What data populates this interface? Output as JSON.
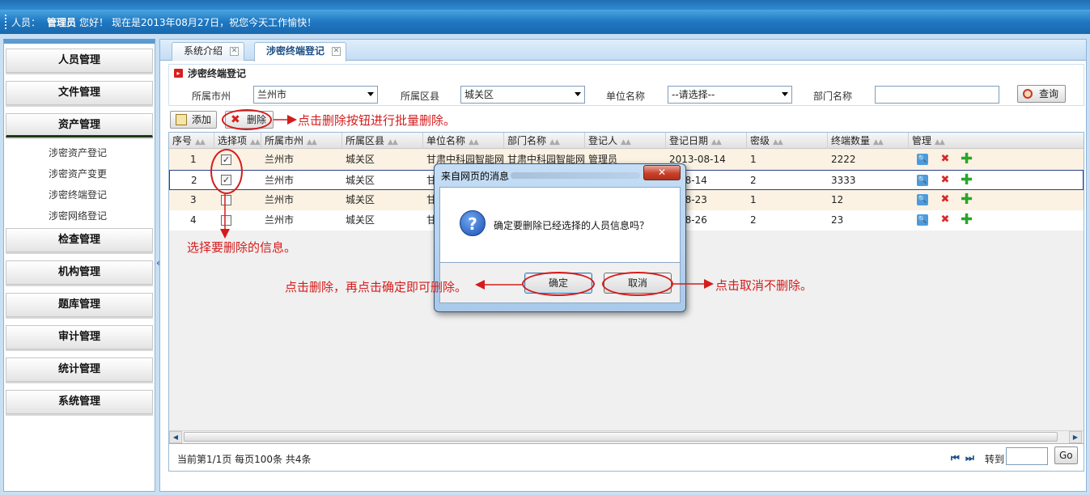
{
  "header": {
    "user_label": "人员：",
    "user_name": "管理员",
    "greeting": "您好！",
    "date_message": "现在是2013年08月27日，祝您今天工作愉快！"
  },
  "sidebar": {
    "menus": [
      {
        "label": "人员管理"
      },
      {
        "label": "文件管理"
      },
      {
        "label": "资产管理"
      },
      {
        "label": "检查管理"
      },
      {
        "label": "机构管理"
      },
      {
        "label": "题库管理"
      },
      {
        "label": "审计管理"
      },
      {
        "label": "统计管理"
      },
      {
        "label": "系统管理"
      }
    ],
    "asset_submenu": [
      "涉密资产登记",
      "涉密资产变更",
      "涉密终端登记",
      "涉密网络登记"
    ],
    "collapse_glyph": "«"
  },
  "tabs": [
    {
      "label": "系统介绍",
      "active": false
    },
    {
      "label": "涉密终端登记",
      "active": true
    }
  ],
  "panel": {
    "title": "涉密终端登记",
    "filters": {
      "city_label": "所属市州",
      "city_value": "兰州市",
      "county_label": "所属区县",
      "county_value": "城关区",
      "unit_label": "单位名称",
      "unit_value": "--请选择--",
      "dept_label": "部门名称",
      "dept_value": "",
      "query_label": "查询"
    },
    "toolbar": {
      "add_label": "添加",
      "delete_label": "删除"
    }
  },
  "grid": {
    "columns": [
      "序号",
      "选择项",
      "所属市州",
      "所属区县",
      "单位名称",
      "部门名称",
      "登记人",
      "登记日期",
      "密级",
      "终端数量",
      "管理"
    ],
    "rows": [
      {
        "no": "1",
        "checked": true,
        "city": "兰州市",
        "county": "城关区",
        "unit": "甘肃中科园智能网",
        "dept": "甘肃中科园智能网",
        "registrar": "管理员",
        "date": "2013-08-14",
        "level": "1",
        "count": "2222"
      },
      {
        "no": "2",
        "checked": true,
        "city": "兰州市",
        "county": "城关区",
        "unit": "甘",
        "dept": "",
        "registrar": "",
        "date": "3-08-14",
        "level": "2",
        "count": "3333"
      },
      {
        "no": "3",
        "checked": false,
        "city": "兰州市",
        "county": "城关区",
        "unit": "甘",
        "dept": "",
        "registrar": "",
        "date": "3-08-23",
        "level": "1",
        "count": "12"
      },
      {
        "no": "4",
        "checked": false,
        "city": "兰州市",
        "county": "城关区",
        "unit": "甘",
        "dept": "",
        "registrar": "",
        "date": "3-08-26",
        "level": "2",
        "count": "23"
      }
    ],
    "selected_row": 1,
    "checkmark": "✓"
  },
  "pager": {
    "info": "当前第1/1页  每页100条  共4条",
    "first_glyph": "⏮",
    "last_glyph": "⏭",
    "goto_label": "转到",
    "go_label": "Go"
  },
  "dialog": {
    "title": "来自网页的消息",
    "close_glyph": "✕",
    "question_glyph": "?",
    "message": "确定要删除已经选择的人员信息吗？",
    "ok_label": "确定",
    "cancel_label": "取消"
  },
  "annotations": {
    "delete_hint": "点击删除按钮进行批量删除。",
    "select_hint": "选择要删除的信息。",
    "confirm_hint": "点击删除，再点击确定即可删除。",
    "cancel_hint": "点击取消不删除。"
  },
  "colors": {
    "header_blue": "#1f78c1",
    "annotation_red": "#d41c1c",
    "row_highlight": "#fbf2e3"
  }
}
